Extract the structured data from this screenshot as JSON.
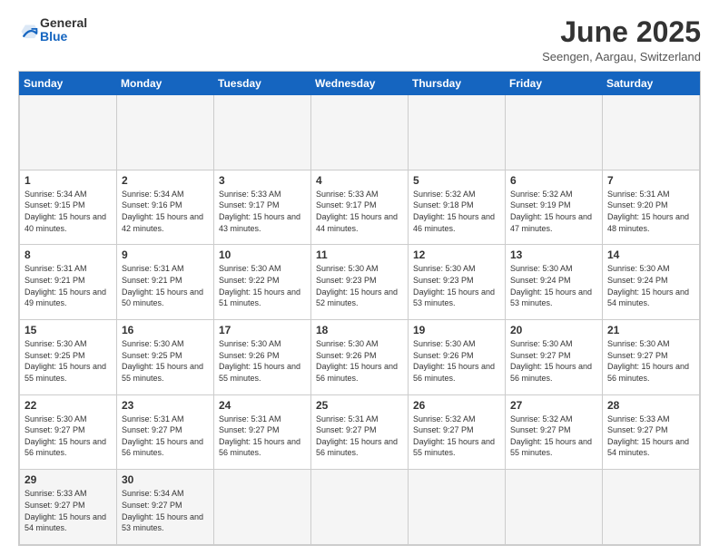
{
  "header": {
    "logo_general": "General",
    "logo_blue": "Blue",
    "month_title": "June 2025",
    "location": "Seengen, Aargau, Switzerland"
  },
  "calendar": {
    "days_of_week": [
      "Sunday",
      "Monday",
      "Tuesday",
      "Wednesday",
      "Thursday",
      "Friday",
      "Saturday"
    ],
    "weeks": [
      [
        {
          "day": "",
          "empty": true
        },
        {
          "day": "",
          "empty": true
        },
        {
          "day": "",
          "empty": true
        },
        {
          "day": "",
          "empty": true
        },
        {
          "day": "",
          "empty": true
        },
        {
          "day": "",
          "empty": true
        },
        {
          "day": "",
          "empty": true
        }
      ],
      [
        {
          "day": "1",
          "sunrise": "5:34 AM",
          "sunset": "9:15 PM",
          "daylight": "15 hours and 40 minutes."
        },
        {
          "day": "2",
          "sunrise": "5:34 AM",
          "sunset": "9:16 PM",
          "daylight": "15 hours and 42 minutes."
        },
        {
          "day": "3",
          "sunrise": "5:33 AM",
          "sunset": "9:17 PM",
          "daylight": "15 hours and 43 minutes."
        },
        {
          "day": "4",
          "sunrise": "5:33 AM",
          "sunset": "9:17 PM",
          "daylight": "15 hours and 44 minutes."
        },
        {
          "day": "5",
          "sunrise": "5:32 AM",
          "sunset": "9:18 PM",
          "daylight": "15 hours and 46 minutes."
        },
        {
          "day": "6",
          "sunrise": "5:32 AM",
          "sunset": "9:19 PM",
          "daylight": "15 hours and 47 minutes."
        },
        {
          "day": "7",
          "sunrise": "5:31 AM",
          "sunset": "9:20 PM",
          "daylight": "15 hours and 48 minutes."
        }
      ],
      [
        {
          "day": "8",
          "sunrise": "5:31 AM",
          "sunset": "9:21 PM",
          "daylight": "15 hours and 49 minutes."
        },
        {
          "day": "9",
          "sunrise": "5:31 AM",
          "sunset": "9:21 PM",
          "daylight": "15 hours and 50 minutes."
        },
        {
          "day": "10",
          "sunrise": "5:30 AM",
          "sunset": "9:22 PM",
          "daylight": "15 hours and 51 minutes."
        },
        {
          "day": "11",
          "sunrise": "5:30 AM",
          "sunset": "9:23 PM",
          "daylight": "15 hours and 52 minutes."
        },
        {
          "day": "12",
          "sunrise": "5:30 AM",
          "sunset": "9:23 PM",
          "daylight": "15 hours and 53 minutes."
        },
        {
          "day": "13",
          "sunrise": "5:30 AM",
          "sunset": "9:24 PM",
          "daylight": "15 hours and 53 minutes."
        },
        {
          "day": "14",
          "sunrise": "5:30 AM",
          "sunset": "9:24 PM",
          "daylight": "15 hours and 54 minutes."
        }
      ],
      [
        {
          "day": "15",
          "sunrise": "5:30 AM",
          "sunset": "9:25 PM",
          "daylight": "15 hours and 55 minutes."
        },
        {
          "day": "16",
          "sunrise": "5:30 AM",
          "sunset": "9:25 PM",
          "daylight": "15 hours and 55 minutes."
        },
        {
          "day": "17",
          "sunrise": "5:30 AM",
          "sunset": "9:26 PM",
          "daylight": "15 hours and 55 minutes."
        },
        {
          "day": "18",
          "sunrise": "5:30 AM",
          "sunset": "9:26 PM",
          "daylight": "15 hours and 56 minutes."
        },
        {
          "day": "19",
          "sunrise": "5:30 AM",
          "sunset": "9:26 PM",
          "daylight": "15 hours and 56 minutes."
        },
        {
          "day": "20",
          "sunrise": "5:30 AM",
          "sunset": "9:27 PM",
          "daylight": "15 hours and 56 minutes."
        },
        {
          "day": "21",
          "sunrise": "5:30 AM",
          "sunset": "9:27 PM",
          "daylight": "15 hours and 56 minutes."
        }
      ],
      [
        {
          "day": "22",
          "sunrise": "5:30 AM",
          "sunset": "9:27 PM",
          "daylight": "15 hours and 56 minutes."
        },
        {
          "day": "23",
          "sunrise": "5:31 AM",
          "sunset": "9:27 PM",
          "daylight": "15 hours and 56 minutes."
        },
        {
          "day": "24",
          "sunrise": "5:31 AM",
          "sunset": "9:27 PM",
          "daylight": "15 hours and 56 minutes."
        },
        {
          "day": "25",
          "sunrise": "5:31 AM",
          "sunset": "9:27 PM",
          "daylight": "15 hours and 56 minutes."
        },
        {
          "day": "26",
          "sunrise": "5:32 AM",
          "sunset": "9:27 PM",
          "daylight": "15 hours and 55 minutes."
        },
        {
          "day": "27",
          "sunrise": "5:32 AM",
          "sunset": "9:27 PM",
          "daylight": "15 hours and 55 minutes."
        },
        {
          "day": "28",
          "sunrise": "5:33 AM",
          "sunset": "9:27 PM",
          "daylight": "15 hours and 54 minutes."
        }
      ],
      [
        {
          "day": "29",
          "sunrise": "5:33 AM",
          "sunset": "9:27 PM",
          "daylight": "15 hours and 54 minutes."
        },
        {
          "day": "30",
          "sunrise": "5:34 AM",
          "sunset": "9:27 PM",
          "daylight": "15 hours and 53 minutes."
        },
        {
          "day": "",
          "empty": true
        },
        {
          "day": "",
          "empty": true
        },
        {
          "day": "",
          "empty": true
        },
        {
          "day": "",
          "empty": true
        },
        {
          "day": "",
          "empty": true
        }
      ]
    ]
  }
}
